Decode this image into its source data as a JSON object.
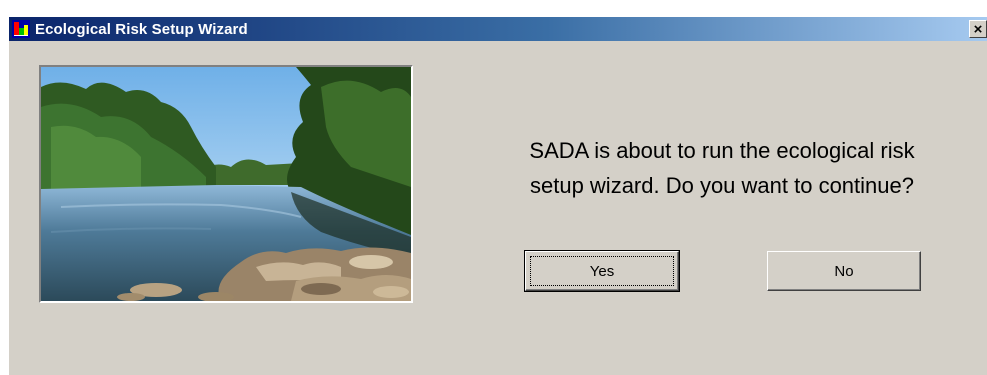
{
  "window": {
    "title": "Ecological Risk Setup Wizard",
    "close_glyph": "×",
    "app_icon": "sada-app-icon",
    "close_icon": "close-icon"
  },
  "illustration": {
    "subject": "river-landscape-photo"
  },
  "message": {
    "line1": "SADA is about to run the ecological risk",
    "line2": "setup wizard. Do you want to continue?"
  },
  "buttons": {
    "yes_label": "Yes",
    "no_label": "No"
  },
  "colors": {
    "title_start": "#0a246a",
    "title_end": "#a6caf0",
    "face": "#d4d0c8"
  }
}
